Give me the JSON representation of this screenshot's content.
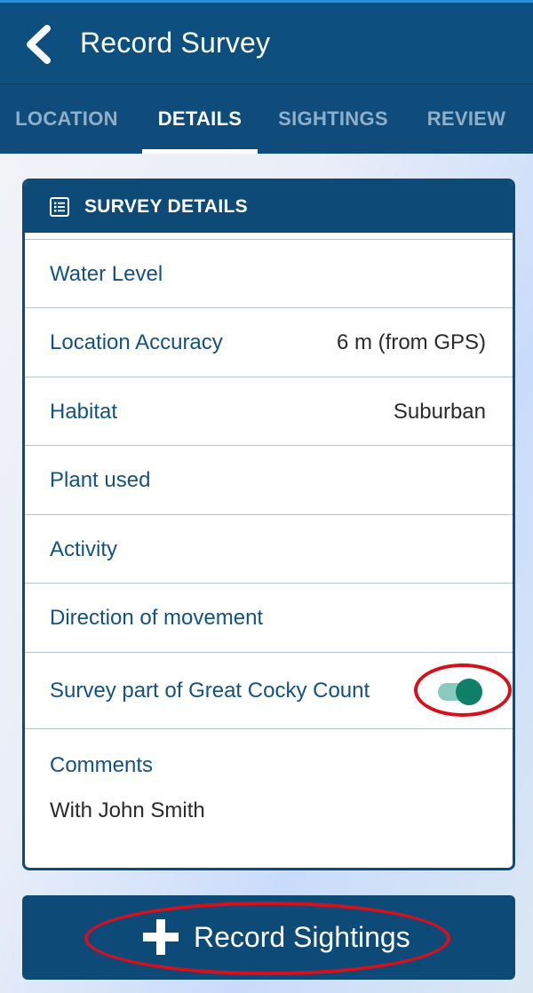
{
  "header": {
    "title": "Record Survey"
  },
  "tabs": [
    {
      "label": "LOCATION",
      "active": false
    },
    {
      "label": "DETAILS",
      "active": true
    },
    {
      "label": "SIGHTINGS",
      "active": false
    },
    {
      "label": "REVIEW",
      "active": false
    }
  ],
  "card": {
    "title": "SURVEY DETAILS",
    "rows": [
      {
        "label": "Water Level",
        "value": ""
      },
      {
        "label": "Location Accuracy",
        "value": "6 m (from GPS)"
      },
      {
        "label": "Habitat",
        "value": "Suburban"
      },
      {
        "label": "Plant used",
        "value": ""
      },
      {
        "label": "Activity",
        "value": ""
      },
      {
        "label": "Direction of movement",
        "value": ""
      }
    ],
    "toggle_row": {
      "label": "Survey part of Great Cocky Count",
      "on": true
    },
    "comments": {
      "label": "Comments",
      "value": "With John Smith"
    }
  },
  "action": {
    "label": "Record Sightings"
  },
  "colors": {
    "primary": "#0e4a78",
    "toggle_on": "#0f8068",
    "annotation": "#d8101c"
  },
  "icons": {
    "back": "chevron-left-icon",
    "details": "list-icon",
    "add": "plus-icon"
  }
}
